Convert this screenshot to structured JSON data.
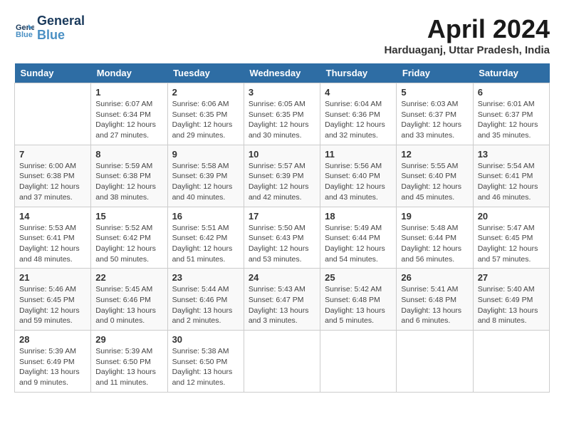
{
  "header": {
    "logo_line1": "General",
    "logo_line2": "Blue",
    "month": "April 2024",
    "location": "Harduaganj, Uttar Pradesh, India"
  },
  "weekdays": [
    "Sunday",
    "Monday",
    "Tuesday",
    "Wednesday",
    "Thursday",
    "Friday",
    "Saturday"
  ],
  "weeks": [
    [
      {
        "day": "",
        "info": ""
      },
      {
        "day": "1",
        "info": "Sunrise: 6:07 AM\nSunset: 6:34 PM\nDaylight: 12 hours\nand 27 minutes."
      },
      {
        "day": "2",
        "info": "Sunrise: 6:06 AM\nSunset: 6:35 PM\nDaylight: 12 hours\nand 29 minutes."
      },
      {
        "day": "3",
        "info": "Sunrise: 6:05 AM\nSunset: 6:35 PM\nDaylight: 12 hours\nand 30 minutes."
      },
      {
        "day": "4",
        "info": "Sunrise: 6:04 AM\nSunset: 6:36 PM\nDaylight: 12 hours\nand 32 minutes."
      },
      {
        "day": "5",
        "info": "Sunrise: 6:03 AM\nSunset: 6:37 PM\nDaylight: 12 hours\nand 33 minutes."
      },
      {
        "day": "6",
        "info": "Sunrise: 6:01 AM\nSunset: 6:37 PM\nDaylight: 12 hours\nand 35 minutes."
      }
    ],
    [
      {
        "day": "7",
        "info": "Sunrise: 6:00 AM\nSunset: 6:38 PM\nDaylight: 12 hours\nand 37 minutes."
      },
      {
        "day": "8",
        "info": "Sunrise: 5:59 AM\nSunset: 6:38 PM\nDaylight: 12 hours\nand 38 minutes."
      },
      {
        "day": "9",
        "info": "Sunrise: 5:58 AM\nSunset: 6:39 PM\nDaylight: 12 hours\nand 40 minutes."
      },
      {
        "day": "10",
        "info": "Sunrise: 5:57 AM\nSunset: 6:39 PM\nDaylight: 12 hours\nand 42 minutes."
      },
      {
        "day": "11",
        "info": "Sunrise: 5:56 AM\nSunset: 6:40 PM\nDaylight: 12 hours\nand 43 minutes."
      },
      {
        "day": "12",
        "info": "Sunrise: 5:55 AM\nSunset: 6:40 PM\nDaylight: 12 hours\nand 45 minutes."
      },
      {
        "day": "13",
        "info": "Sunrise: 5:54 AM\nSunset: 6:41 PM\nDaylight: 12 hours\nand 46 minutes."
      }
    ],
    [
      {
        "day": "14",
        "info": "Sunrise: 5:53 AM\nSunset: 6:41 PM\nDaylight: 12 hours\nand 48 minutes."
      },
      {
        "day": "15",
        "info": "Sunrise: 5:52 AM\nSunset: 6:42 PM\nDaylight: 12 hours\nand 50 minutes."
      },
      {
        "day": "16",
        "info": "Sunrise: 5:51 AM\nSunset: 6:42 PM\nDaylight: 12 hours\nand 51 minutes."
      },
      {
        "day": "17",
        "info": "Sunrise: 5:50 AM\nSunset: 6:43 PM\nDaylight: 12 hours\nand 53 minutes."
      },
      {
        "day": "18",
        "info": "Sunrise: 5:49 AM\nSunset: 6:44 PM\nDaylight: 12 hours\nand 54 minutes."
      },
      {
        "day": "19",
        "info": "Sunrise: 5:48 AM\nSunset: 6:44 PM\nDaylight: 12 hours\nand 56 minutes."
      },
      {
        "day": "20",
        "info": "Sunrise: 5:47 AM\nSunset: 6:45 PM\nDaylight: 12 hours\nand 57 minutes."
      }
    ],
    [
      {
        "day": "21",
        "info": "Sunrise: 5:46 AM\nSunset: 6:45 PM\nDaylight: 12 hours\nand 59 minutes."
      },
      {
        "day": "22",
        "info": "Sunrise: 5:45 AM\nSunset: 6:46 PM\nDaylight: 13 hours\nand 0 minutes."
      },
      {
        "day": "23",
        "info": "Sunrise: 5:44 AM\nSunset: 6:46 PM\nDaylight: 13 hours\nand 2 minutes."
      },
      {
        "day": "24",
        "info": "Sunrise: 5:43 AM\nSunset: 6:47 PM\nDaylight: 13 hours\nand 3 minutes."
      },
      {
        "day": "25",
        "info": "Sunrise: 5:42 AM\nSunset: 6:48 PM\nDaylight: 13 hours\nand 5 minutes."
      },
      {
        "day": "26",
        "info": "Sunrise: 5:41 AM\nSunset: 6:48 PM\nDaylight: 13 hours\nand 6 minutes."
      },
      {
        "day": "27",
        "info": "Sunrise: 5:40 AM\nSunset: 6:49 PM\nDaylight: 13 hours\nand 8 minutes."
      }
    ],
    [
      {
        "day": "28",
        "info": "Sunrise: 5:39 AM\nSunset: 6:49 PM\nDaylight: 13 hours\nand 9 minutes."
      },
      {
        "day": "29",
        "info": "Sunrise: 5:39 AM\nSunset: 6:50 PM\nDaylight: 13 hours\nand 11 minutes."
      },
      {
        "day": "30",
        "info": "Sunrise: 5:38 AM\nSunset: 6:50 PM\nDaylight: 13 hours\nand 12 minutes."
      },
      {
        "day": "",
        "info": ""
      },
      {
        "day": "",
        "info": ""
      },
      {
        "day": "",
        "info": ""
      },
      {
        "day": "",
        "info": ""
      }
    ]
  ]
}
